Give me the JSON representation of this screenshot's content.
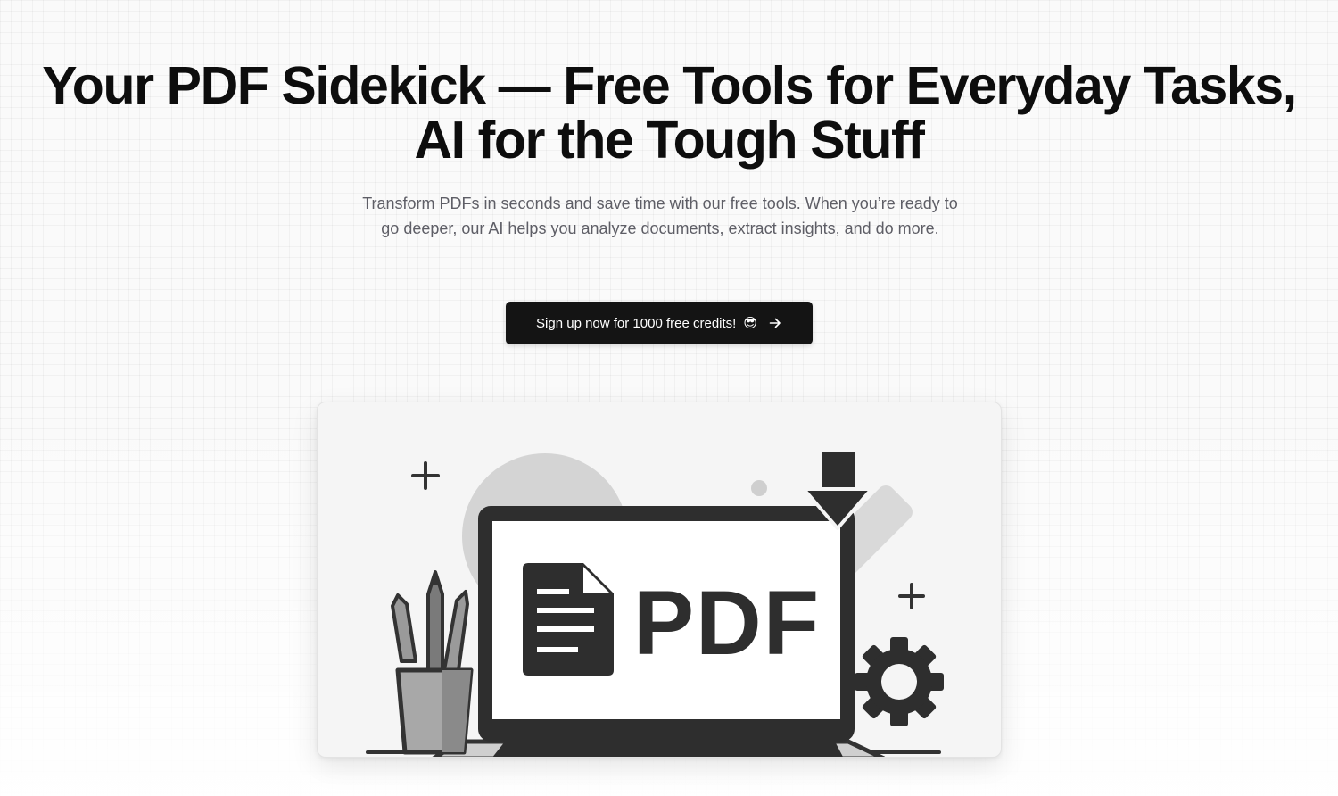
{
  "hero": {
    "headline_line1": "Your PDF Sidekick — Free Tools for Everyday Tasks,",
    "headline_line2": "AI for the Tough Stuff",
    "subtext": "Transform PDFs in seconds and save time with our free tools. When you’re ready to go deeper, our AI helps you analyze documents, extract insights, and do more.",
    "cta_label": "Sign up now for 1000 free credits!",
    "cta_emoji": "😎",
    "cta_icon": "arrow-right-icon"
  },
  "illustration": {
    "screen_text": "PDF",
    "icons": [
      "plus-icon",
      "download-arrow-icon",
      "pencil-icon",
      "document-icon",
      "gear-icon",
      "pencil-cup-icon"
    ]
  },
  "colors": {
    "background": "#fafafa",
    "headline": "#0d0d0d",
    "subtext": "#5e5e66",
    "cta_background": "#141414",
    "cta_text": "#ffffff"
  }
}
